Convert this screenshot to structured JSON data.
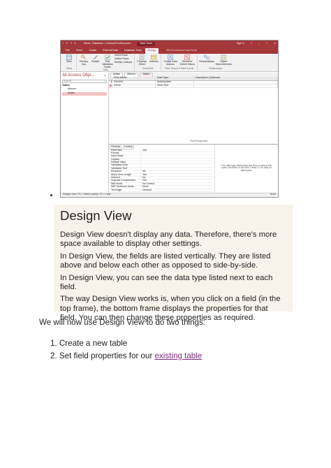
{
  "screenshot": {
    "window_title": "Music : Database- C:\\Users\\Fred\\Docume...",
    "contextual_tab": "Table Tools",
    "sign_in": "Sign in",
    "ribbon_tabs": [
      "File",
      "Home",
      "Create",
      "External Data",
      "Database Tools",
      "Design"
    ],
    "active_tab": "Design",
    "tell_me": "Tell me what you want to do",
    "groups": {
      "views": {
        "name": "Views",
        "view": "View"
      },
      "tools": {
        "name": "Tools",
        "primary_key": "Primary Key",
        "builder": "Builder",
        "test_rules": "Test Validation Rules",
        "insert_rows": "Insert Rows",
        "delete_rows": "Delete Rows",
        "modify_lookups": "Modify Lookups"
      },
      "show_hide": {
        "name": "Show/Hide",
        "property_sheet": "Property Sheet",
        "indexes": "Indexes"
      },
      "events": {
        "name": "Field, Record & Table Events",
        "data_macros": "Create Data Macros",
        "rename_delete": "Rename/ Delete Macro"
      },
      "relationships": {
        "name": "Relationships",
        "relationships": "Relationships",
        "dependencies": "Object Dependencies"
      }
    },
    "nav": {
      "title": "All Access Obje...",
      "search_placeholder": "Search...",
      "section": "Tables",
      "items": [
        "Albums",
        "Artists"
      ]
    },
    "doc_tabs": [
      "Artists",
      "Albums",
      "Table1"
    ],
    "grid": {
      "headers": [
        "Field Name",
        "Data Type",
        "Description (Optional)"
      ],
      "rows": [
        {
          "field": "GenreId",
          "type": "AutoNumber"
        },
        {
          "field": "Genre",
          "type": "Short Text"
        }
      ]
    },
    "field_properties_label": "Field Properties",
    "prop_tabs": [
      "General",
      "Lookup"
    ],
    "properties": [
      {
        "k": "Field Size",
        "v": "255"
      },
      {
        "k": "Format",
        "v": ""
      },
      {
        "k": "Input Mask",
        "v": ""
      },
      {
        "k": "Caption",
        "v": ""
      },
      {
        "k": "Default Value",
        "v": ""
      },
      {
        "k": "Validation Rule",
        "v": ""
      },
      {
        "k": "Validation Text",
        "v": ""
      },
      {
        "k": "Required",
        "v": "No"
      },
      {
        "k": "Allow Zero Length",
        "v": "Yes"
      },
      {
        "k": "Indexed",
        "v": "No"
      },
      {
        "k": "Unicode Compression",
        "v": "Yes"
      },
      {
        "k": "IME Mode",
        "v": "No Control"
      },
      {
        "k": "IME Sentence Mode",
        "v": "None"
      },
      {
        "k": "Text Align",
        "v": "General"
      }
    ],
    "help_text": "The data type determines the kind of values that users can store in the field. Press F1 for help on data types.",
    "status_text": "Design view. F6 = Switch panes. F1 = Help.",
    "status_right": "NUM"
  },
  "panel": {
    "title": "Design View",
    "paragraphs": [
      "Design View doesn't display any data. Therefore, there's more space available to display other settings.",
      "In Design View, the fields are listed vertically. They are listed above and below each other as opposed to side-by-side.",
      "In Design View, you can see the data type listed next to each field.",
      "The way Design View works is, when you click on a field (in the top frame), the bottom frame displays the properties for that field. You can then change these properties as required."
    ]
  },
  "lead": "We will now use Design View to do two things:",
  "steps": {
    "step1_num": "1.",
    "step1": "Create a new table",
    "step2_num": "2.",
    "step2_text": "Set field properties for our ",
    "step2_link": "existing table"
  }
}
